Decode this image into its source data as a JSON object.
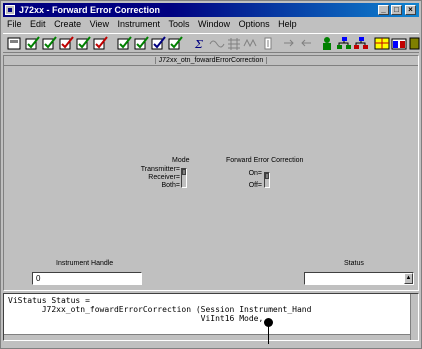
{
  "window": {
    "title": "J72xx - Forward Error Correction",
    "minimize": "_",
    "maximize": "□",
    "close": "×"
  },
  "menu": [
    "File",
    "Edit",
    "Create",
    "View",
    "Instrument",
    "Tools",
    "Window",
    "Options",
    "Help"
  ],
  "toolbar_icons": [
    "panel-icon",
    "check-icon",
    "check-icon",
    "check-icon",
    "check-icon",
    "check-icon",
    "check-icon",
    "check-icon",
    "check-icon",
    "check-icon",
    "function-icon",
    "sine-icon",
    "grid-icon",
    "wave-icon",
    "gauge-icon",
    "arrow-icon",
    "arrow-icon",
    "green-man-icon",
    "tree-icon",
    "tree-icon",
    "grid-icon",
    "folder-icon",
    "book-icon"
  ],
  "panel": {
    "title": "J72xx_otn_fowardErrorCorrection",
    "mode_label": "Mode",
    "mode_options": [
      "Transmitter",
      "Receiver",
      "Both"
    ],
    "fec_label": "Forward Error Correction",
    "fec_options": [
      "On",
      "Off"
    ],
    "handle_label": "Instrument Handle",
    "handle_value": "0",
    "status_label": "Status",
    "status_value": ""
  },
  "code": {
    "line1": "ViStatus Status =",
    "line2": "       J72xx_otn_fowardErrorCorrection (Session Instrument_Hand",
    "line3": "                                        ViInt16 Mode,"
  },
  "colors": {
    "titlebar": "#000080",
    "face": "#c0c0c0"
  }
}
